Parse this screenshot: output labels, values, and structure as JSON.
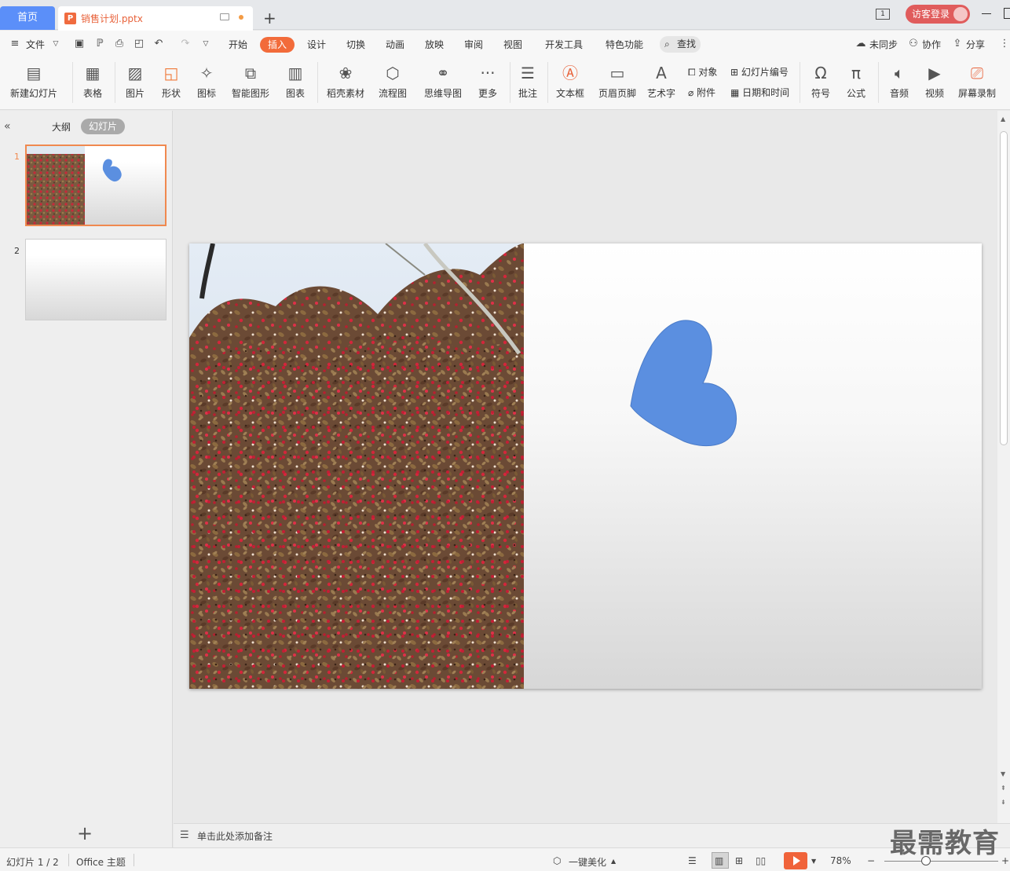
{
  "tabs": {
    "home": "首页",
    "doc_title": "销售计划.pptx",
    "add": "+"
  },
  "window": {
    "page_indicator": "1",
    "login": "访客登录"
  },
  "menu": {
    "file": "文件",
    "items": [
      "开始",
      "插入",
      "设计",
      "切换",
      "动画",
      "放映",
      "审阅",
      "视图",
      "开发工具",
      "特色功能"
    ],
    "active": "插入",
    "search": "查找",
    "sync": "未同步",
    "collab": "协作",
    "share": "分享"
  },
  "ribbon": {
    "new_slide": "新建幻灯片",
    "table": "表格",
    "picture": "图片",
    "shape": "形状",
    "icon": "图标",
    "smartart": "智能图形",
    "chart": "图表",
    "docer": "稻壳素材",
    "flowchart": "流程图",
    "mindmap": "思维导图",
    "more": "更多",
    "comment": "批注",
    "textbox": "文本框",
    "header_footer": "页眉页脚",
    "wordart": "艺术字",
    "object": "对象",
    "attachment": "附件",
    "slide_number": "幻灯片编号",
    "datetime": "日期和时间",
    "symbol": "符号",
    "formula": "公式",
    "audio": "音频",
    "video": "视频",
    "screen_record": "屏幕录制"
  },
  "leftpanel": {
    "tab_outline": "大纲",
    "tab_slides": "幻灯片",
    "slide1_num": "1",
    "slide2_num": "2"
  },
  "notes": {
    "placeholder": "单击此处添加备注"
  },
  "status": {
    "slide_info": "幻灯片 1 / 2",
    "theme": "Office 主题",
    "beautify": "一键美化",
    "zoom": "78%"
  },
  "watermark": "最需教育",
  "colors": {
    "accent": "#f26b3a",
    "home_tab": "#5b8ff9",
    "heart": "#5b8fe0",
    "login": "#e05c5c"
  }
}
